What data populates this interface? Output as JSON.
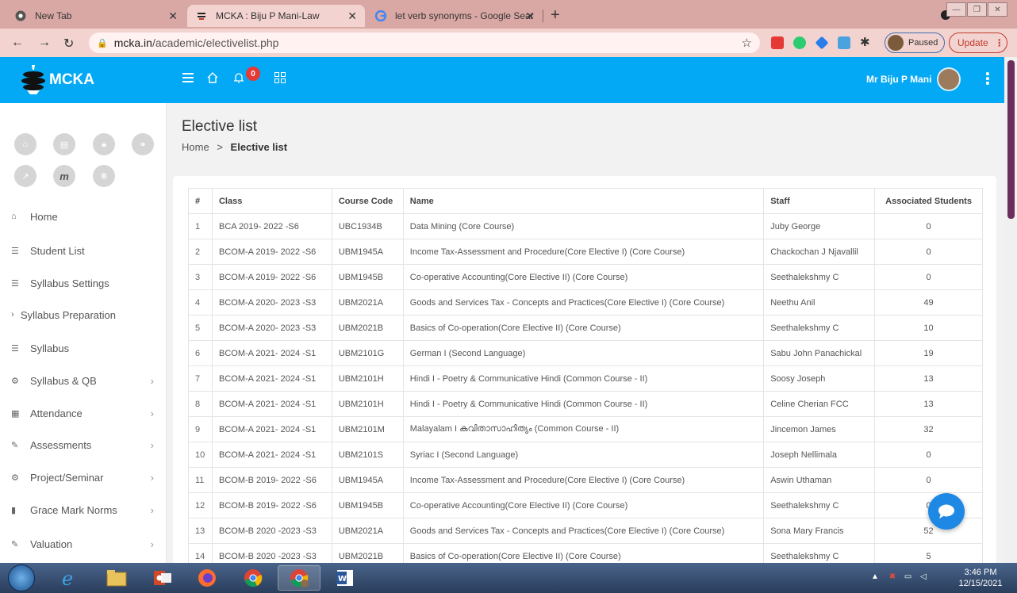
{
  "browser": {
    "tabs": [
      {
        "title": "New Tab",
        "favicon": "chrome-icon"
      },
      {
        "title": "MCKA : Biju P Mani-Law",
        "favicon": "mcka-icon"
      },
      {
        "title": "let verb synonyms - Google Sear",
        "favicon": "google-icon"
      }
    ],
    "url_host": "mcka.in",
    "url_path": "/academic/electivelist.php",
    "profile_label": "Paused",
    "update_label": "Update"
  },
  "header": {
    "brand": "MCKA",
    "notification_count": "0",
    "user_name": "Mr Biju P Mani",
    "accent": "#03a9f4"
  },
  "sidebar": {
    "quick_icons": [
      "home-icon",
      "id-card-icon",
      "lock-icon",
      "handshake-icon",
      "external-link-icon",
      "m-icon",
      "gear-icon"
    ],
    "items": [
      {
        "label": "Home",
        "icon": "home-icon",
        "chevron": ""
      },
      {
        "label": "Student List",
        "icon": "list-icon",
        "chevron": ""
      },
      {
        "label": "Syllabus Settings",
        "icon": "list-icon",
        "chevron": ""
      },
      {
        "label": "Syllabus Preparation",
        "icon": "chevron-right-icon",
        "chevron": ""
      },
      {
        "label": "Syllabus",
        "icon": "list-icon",
        "chevron": ""
      },
      {
        "label": "Syllabus & QB",
        "icon": "cogs-icon",
        "chevron": "›"
      },
      {
        "label": "Attendance",
        "icon": "calendar-icon",
        "chevron": "›"
      },
      {
        "label": "Assessments",
        "icon": "pencil-icon",
        "chevron": "›"
      },
      {
        "label": "Project/Seminar",
        "icon": "cogs-icon",
        "chevron": "›"
      },
      {
        "label": "Grace Mark Norms",
        "icon": "book-icon",
        "chevron": "›"
      },
      {
        "label": "Valuation",
        "icon": "pencil-icon",
        "chevron": "›"
      }
    ]
  },
  "page": {
    "title": "Elective list",
    "breadcrumb_home": "Home",
    "breadcrumb_sep": ">",
    "breadcrumb_current": "Elective list"
  },
  "table": {
    "headers": [
      "#",
      "Class",
      "Course Code",
      "Name",
      "Staff",
      "Associated Students"
    ],
    "rows": [
      [
        "1",
        "BCA 2019- 2022 -S6",
        "UBC1934B",
        "Data Mining (Core Course)",
        "Juby George",
        "0"
      ],
      [
        "2",
        "BCOM-A 2019- 2022 -S6",
        "UBM1945A",
        "Income Tax-Assessment and Procedure(Core Elective I) (Core Course)",
        "Chackochan J Njavallil",
        "0"
      ],
      [
        "3",
        "BCOM-A 2019- 2022 -S6",
        "UBM1945B",
        "Co-operative Accounting(Core Elective II) (Core Course)",
        "Seethalekshmy C",
        "0"
      ],
      [
        "4",
        "BCOM-A 2020- 2023 -S3",
        "UBM2021A",
        "Goods and Services Tax - Concepts and Practices(Core Elective I) (Core Course)",
        "Neethu Anil",
        "49"
      ],
      [
        "5",
        "BCOM-A 2020- 2023 -S3",
        "UBM2021B",
        "Basics of Co-operation(Core Elective II) (Core Course)",
        "Seethalekshmy C",
        "10"
      ],
      [
        "6",
        "BCOM-A 2021- 2024 -S1",
        "UBM2101G",
        "German I (Second Language)",
        "Sabu John Panachickal",
        "19"
      ],
      [
        "7",
        "BCOM-A 2021- 2024 -S1",
        "UBM2101H",
        "Hindi I - Poetry & Communicative Hindi (Common Course - II)",
        "Soosy Joseph",
        "13"
      ],
      [
        "8",
        "BCOM-A 2021- 2024 -S1",
        "UBM2101H",
        "Hindi I - Poetry & Communicative Hindi (Common Course - II)",
        "Celine Cherian FCC",
        "13"
      ],
      [
        "9",
        "BCOM-A 2021- 2024 -S1",
        "UBM2101M",
        "Malayalam I കവിതാസാഹിത്യം (Common Course - II)",
        "Jincemon James",
        "32"
      ],
      [
        "10",
        "BCOM-A 2021- 2024 -S1",
        "UBM2101S",
        "Syriac I (Second Language)",
        "Joseph Nellimala",
        "0"
      ],
      [
        "11",
        "BCOM-B 2019- 2022 -S6",
        "UBM1945A",
        "Income Tax-Assessment and Procedure(Core Elective I) (Core Course)",
        "Aswin Uthaman",
        "0"
      ],
      [
        "12",
        "BCOM-B 2019- 2022 -S6",
        "UBM1945B",
        "Co-operative Accounting(Core Elective II) (Core Course)",
        "Seethalekshmy C",
        "0"
      ],
      [
        "13",
        "BCOM-B 2020 -2023 -S3",
        "UBM2021A",
        "Goods and Services Tax - Concepts and Practices(Core Elective I) (Core Course)",
        "Sona Mary Francis",
        "52"
      ],
      [
        "14",
        "BCOM-B 2020 -2023 -S3",
        "UBM2021B",
        "Basics of Co-operation(Core Elective II) (Core Course)",
        "Seethalekshmy C",
        "5"
      ]
    ]
  },
  "taskbar": {
    "time": "3:46 PM",
    "date": "12/15/2021"
  }
}
